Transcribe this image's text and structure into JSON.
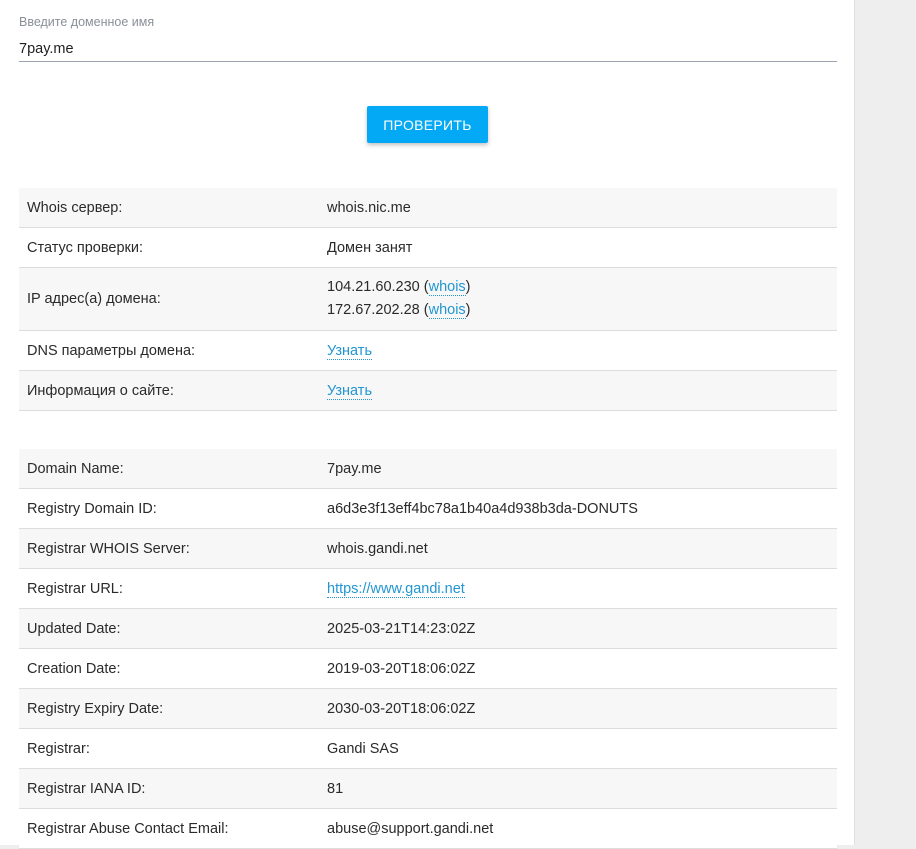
{
  "search": {
    "label": "Введите доменное имя",
    "value": "7pay.me",
    "button": "ПРОВЕРИТЬ"
  },
  "check_table": {
    "whois_server": {
      "key": "Whois сервер:",
      "value": "whois.nic.me"
    },
    "status": {
      "key": "Статус проверки:",
      "value": "Домен занят"
    },
    "ip": {
      "key": "IP адрес(а) домена:",
      "ips": [
        {
          "address": "104.21.60.230",
          "open": " (",
          "link": "whois",
          "close": ")"
        },
        {
          "address": "172.67.202.28",
          "open": " (",
          "link": "whois",
          "close": ")"
        }
      ]
    },
    "dns": {
      "key": "DNS параметры домена:",
      "link": "Узнать"
    },
    "site_info": {
      "key": "Информация о сайте:",
      "link": "Узнать"
    }
  },
  "whois_table": {
    "rows": [
      {
        "key": "Domain Name:",
        "value": "7pay.me"
      },
      {
        "key": "Registry Domain ID:",
        "value": "a6d3e3f13eff4bc78a1b40a4d938b3da-DONUTS"
      },
      {
        "key": "Registrar WHOIS Server:",
        "value": "whois.gandi.net"
      },
      {
        "key": "Registrar URL:",
        "value": "https://www.gandi.net"
      },
      {
        "key": "Updated Date:",
        "value": "2025-03-21T14:23:02Z"
      },
      {
        "key": "Creation Date:",
        "value": "2019-03-20T18:06:02Z"
      },
      {
        "key": "Registry Expiry Date:",
        "value": "2030-03-20T18:06:02Z"
      },
      {
        "key": "Registrar:",
        "value": "Gandi SAS"
      },
      {
        "key": "Registrar IANA ID:",
        "value": "81"
      },
      {
        "key": "Registrar Abuse Contact Email:",
        "value": "abuse@support.gandi.net"
      }
    ]
  },
  "colors": {
    "accent": "#03a9f4",
    "link": "#2196d3",
    "row_alt": "#f7f7f7",
    "page_bg": "#eeeeee"
  }
}
